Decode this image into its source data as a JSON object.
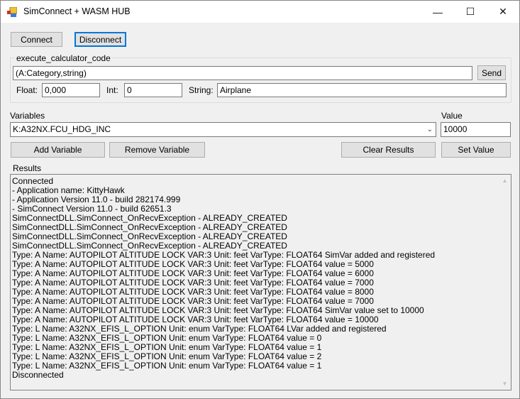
{
  "window": {
    "title": "SimConnect + WASM HUB",
    "minimize": "—",
    "maximize": "☐",
    "close": "✕"
  },
  "buttons": {
    "connect": "Connect",
    "disconnect": "Disconnect",
    "send": "Send",
    "add_variable": "Add Variable",
    "remove_variable": "Remove Variable",
    "clear_results": "Clear Results",
    "set_value": "Set Value"
  },
  "calculator": {
    "group_label": "execute_calculator_code",
    "code": "(A:Category,string)",
    "float_label": "Float:",
    "float_value": "0,000",
    "int_label": "Int:",
    "int_value": "0",
    "string_label": "String:",
    "string_value": "Airplane"
  },
  "variables": {
    "label": "Variables",
    "selected": "K:A32NX.FCU_HDG_INC",
    "value_label": "Value",
    "value": "10000"
  },
  "results": {
    "label": "Results",
    "lines": [
      "Connected",
      "- Application name: KittyHawk",
      "- Application Version 11.0 - build 282174.999",
      "- SimConnect  Version 11.0 - build 62651.3",
      "SimConnectDLL.SimConnect_OnRecvException - ALREADY_CREATED",
      "SimConnectDLL.SimConnect_OnRecvException - ALREADY_CREATED",
      "SimConnectDLL.SimConnect_OnRecvException - ALREADY_CREATED",
      "SimConnectDLL.SimConnect_OnRecvException - ALREADY_CREATED",
      "Type: A Name: AUTOPILOT ALTITUDE LOCK VAR:3 Unit: feet VarType: FLOAT64 SimVar added and registered",
      "Type: A Name: AUTOPILOT ALTITUDE LOCK VAR:3 Unit: feet VarType: FLOAT64 value = 5000",
      "Type: A Name: AUTOPILOT ALTITUDE LOCK VAR:3 Unit: feet VarType: FLOAT64 value = 6000",
      "Type: A Name: AUTOPILOT ALTITUDE LOCK VAR:3 Unit: feet VarType: FLOAT64 value = 7000",
      "Type: A Name: AUTOPILOT ALTITUDE LOCK VAR:3 Unit: feet VarType: FLOAT64 value = 8000",
      "Type: A Name: AUTOPILOT ALTITUDE LOCK VAR:3 Unit: feet VarType: FLOAT64 value = 7000",
      "Type: A Name: AUTOPILOT ALTITUDE LOCK VAR:3 Unit: feet VarType: FLOAT64 SimVar value set to 10000",
      "Type: A Name: AUTOPILOT ALTITUDE LOCK VAR:3 Unit: feet VarType: FLOAT64 value = 10000",
      "Type: L Name: A32NX_EFIS_L_OPTION Unit: enum VarType: FLOAT64 LVar added and registered",
      "Type: L Name: A32NX_EFIS_L_OPTION Unit: enum VarType: FLOAT64 value = 0",
      "Type: L Name: A32NX_EFIS_L_OPTION Unit: enum VarType: FLOAT64 value = 1",
      "Type: L Name: A32NX_EFIS_L_OPTION Unit: enum VarType: FLOAT64 value = 2",
      "Type: L Name: A32NX_EFIS_L_OPTION Unit: enum VarType: FLOAT64 value = 1",
      "Disconnected"
    ]
  }
}
